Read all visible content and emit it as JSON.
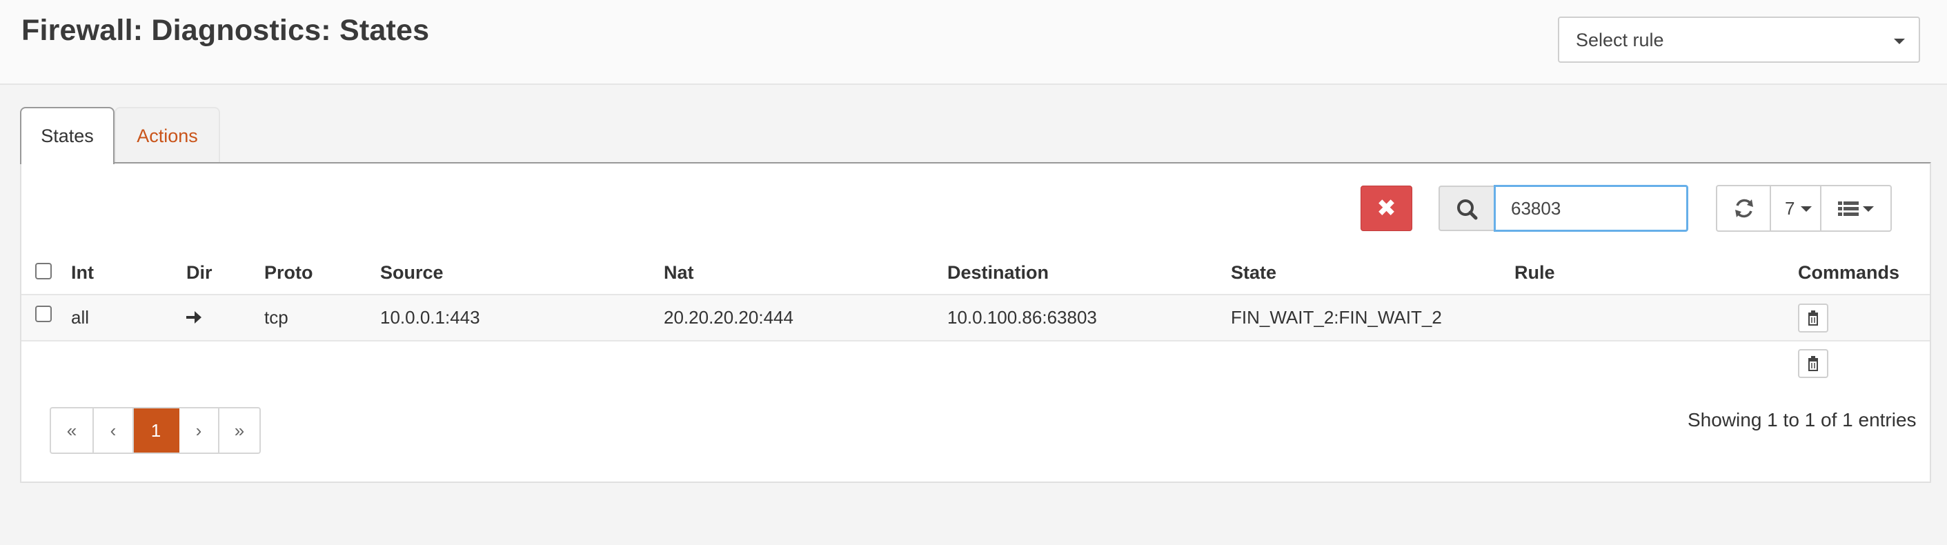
{
  "header": {
    "title": "Firewall: Diagnostics: States",
    "rule_select": {
      "value": "Select rule"
    }
  },
  "tabs": [
    {
      "label": "States",
      "active": true
    },
    {
      "label": "Actions",
      "active": false
    }
  ],
  "toolbar": {
    "clear_icon": "close-icon",
    "search_icon": "search-icon",
    "search_value": "63803",
    "refresh_icon": "refresh-icon",
    "row_count": "7",
    "columns_icon": "list-icon"
  },
  "table": {
    "columns": [
      "Int",
      "Dir",
      "Proto",
      "Source",
      "Nat",
      "Destination",
      "State",
      "Rule",
      "Commands"
    ],
    "rows": [
      {
        "int": "all",
        "dir_icon": "arrow-right-icon",
        "proto": "tcp",
        "source": "10.0.0.1:443",
        "nat": "20.20.20.20:444",
        "destination": "10.0.100.86:63803",
        "state": "FIN_WAIT_2:FIN_WAIT_2",
        "rule": ""
      }
    ]
  },
  "pagination": {
    "first": "«",
    "prev": "‹",
    "current": "1",
    "next": "›",
    "last": "»"
  },
  "footer": {
    "summary": "Showing 1 to 1 of 1 entries"
  },
  "colors": {
    "accent": "#c9541a",
    "danger": "#dc4d4d",
    "focus": "#66afe9"
  }
}
